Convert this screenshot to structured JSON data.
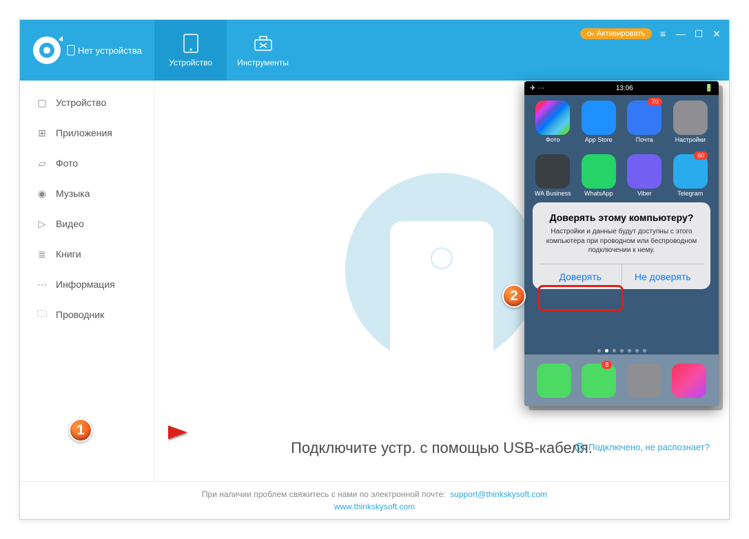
{
  "header": {
    "no_device": "Нет устройства",
    "activate": "Активировать",
    "tabs": {
      "device": "Устройство",
      "tools": "Инструменты"
    }
  },
  "sidebar": {
    "items": [
      {
        "label": "Устройство"
      },
      {
        "label": "Приложения"
      },
      {
        "label": "Фото"
      },
      {
        "label": "Музыка"
      },
      {
        "label": "Видео"
      },
      {
        "label": "Книги"
      },
      {
        "label": "Информация"
      },
      {
        "label": "Проводник"
      }
    ]
  },
  "main": {
    "message": "Подключите устр. с помощью USB-кабеля.",
    "help": "Подключено, не распознает?"
  },
  "footer": {
    "text": "При наличии проблем свяжитесь с нами по электронной почте:",
    "email": "support@thinkskysoft.com",
    "site": "www.thinkskysoft.com"
  },
  "phone": {
    "time": "13:06",
    "apps_row1": [
      {
        "label": "Фото",
        "color": "linear-gradient(135deg,#ff5e3a,#ff2a68,#c644fc,#5856d6,#007aff,#34aadc,#5ac8fa,#4cd964,#ffcc00)"
      },
      {
        "label": "App Store",
        "color": "#1e90ff"
      },
      {
        "label": "Почта",
        "color": "#3478f6",
        "badge": "70"
      },
      {
        "label": "Настройки",
        "color": "#8e8e93"
      }
    ],
    "apps_row2": [
      {
        "label": "WA Business",
        "color": "#3a3f44"
      },
      {
        "label": "WhatsApp",
        "color": "#25d366"
      },
      {
        "label": "Viber",
        "color": "#7360f2"
      },
      {
        "label": "Telegram",
        "color": "#2aabee",
        "badge": "60"
      }
    ],
    "dock": [
      {
        "color": "#4cd964"
      },
      {
        "color": "#4cd964",
        "badge": "8"
      },
      {
        "color": "#8e8e93"
      },
      {
        "color": "linear-gradient(135deg,#fc3158,#f74b9e,#b549ff)"
      }
    ],
    "dialog": {
      "title": "Доверять этому компьютеру?",
      "text": "Настройки и данные будут доступны с этого компьютера при проводном или беспроводном подключении к нему.",
      "trust": "Доверять",
      "dont": "Не доверять"
    }
  },
  "callouts": {
    "one": "1",
    "two": "2"
  }
}
